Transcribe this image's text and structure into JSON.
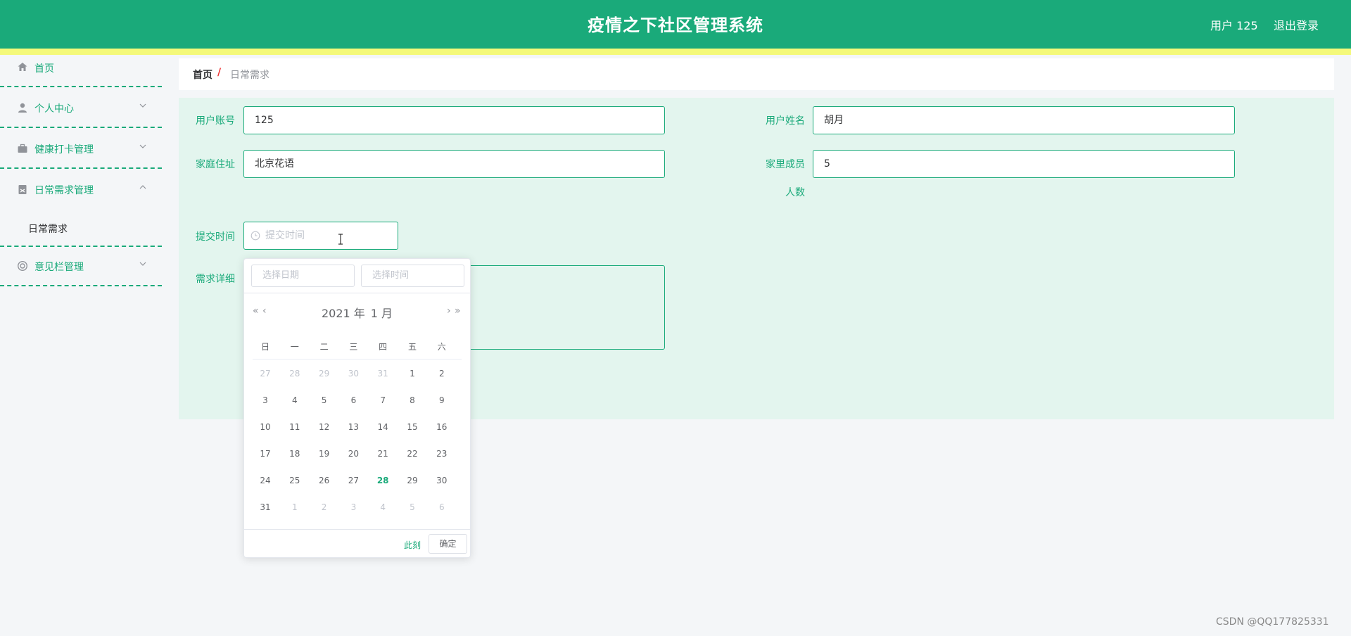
{
  "header": {
    "title": "疫情之下社区管理系统",
    "user": "用户 125",
    "logout": "退出登录",
    "color": "#1aaa7a",
    "strip_color": "#f4f97a"
  },
  "sidebar": {
    "items": [
      {
        "label": "首页",
        "icon": "home-icon"
      },
      {
        "label": "个人中心",
        "icon": "user-icon"
      },
      {
        "label": "健康打卡管理",
        "icon": "briefcase-icon"
      },
      {
        "label": "日常需求管理",
        "icon": "clipboard-icon"
      },
      {
        "label": "意见栏管理",
        "icon": "lifebuoy-icon"
      }
    ],
    "sub_item": "日常需求"
  },
  "breadcrumb": {
    "home": "首页",
    "separator": "/",
    "current": "日常需求"
  },
  "form": {
    "account_label": "用户账号",
    "account_value": "125",
    "name_label": "用户姓名",
    "name_value": "胡月",
    "address_label": "家庭住址",
    "address_value": "北京花语",
    "members_label": "家里成员",
    "members_label2": "人数",
    "members_value": "5",
    "time_label": "提交时间",
    "time_placeholder": "提交时间",
    "detail_label": "需求详细"
  },
  "picker": {
    "date_placeholder": "选择日期",
    "time_placeholder": "选择时间",
    "year": "2021 年",
    "month": "1 月",
    "weekdays": [
      "日",
      "一",
      "二",
      "三",
      "四",
      "五",
      "六"
    ],
    "weeks": [
      [
        "27",
        "28",
        "29",
        "30",
        "31",
        "1",
        "2"
      ],
      [
        "3",
        "4",
        "5",
        "6",
        "7",
        "8",
        "9"
      ],
      [
        "10",
        "11",
        "12",
        "13",
        "14",
        "15",
        "16"
      ],
      [
        "17",
        "18",
        "19",
        "20",
        "21",
        "22",
        "23"
      ],
      [
        "24",
        "25",
        "26",
        "27",
        "28",
        "29",
        "30"
      ],
      [
        "31",
        "1",
        "2",
        "3",
        "4",
        "5",
        "6"
      ]
    ],
    "today": "28",
    "now_label": "此刻",
    "confirm_label": "确定"
  },
  "watermark": "CSDN @QQ177825331"
}
